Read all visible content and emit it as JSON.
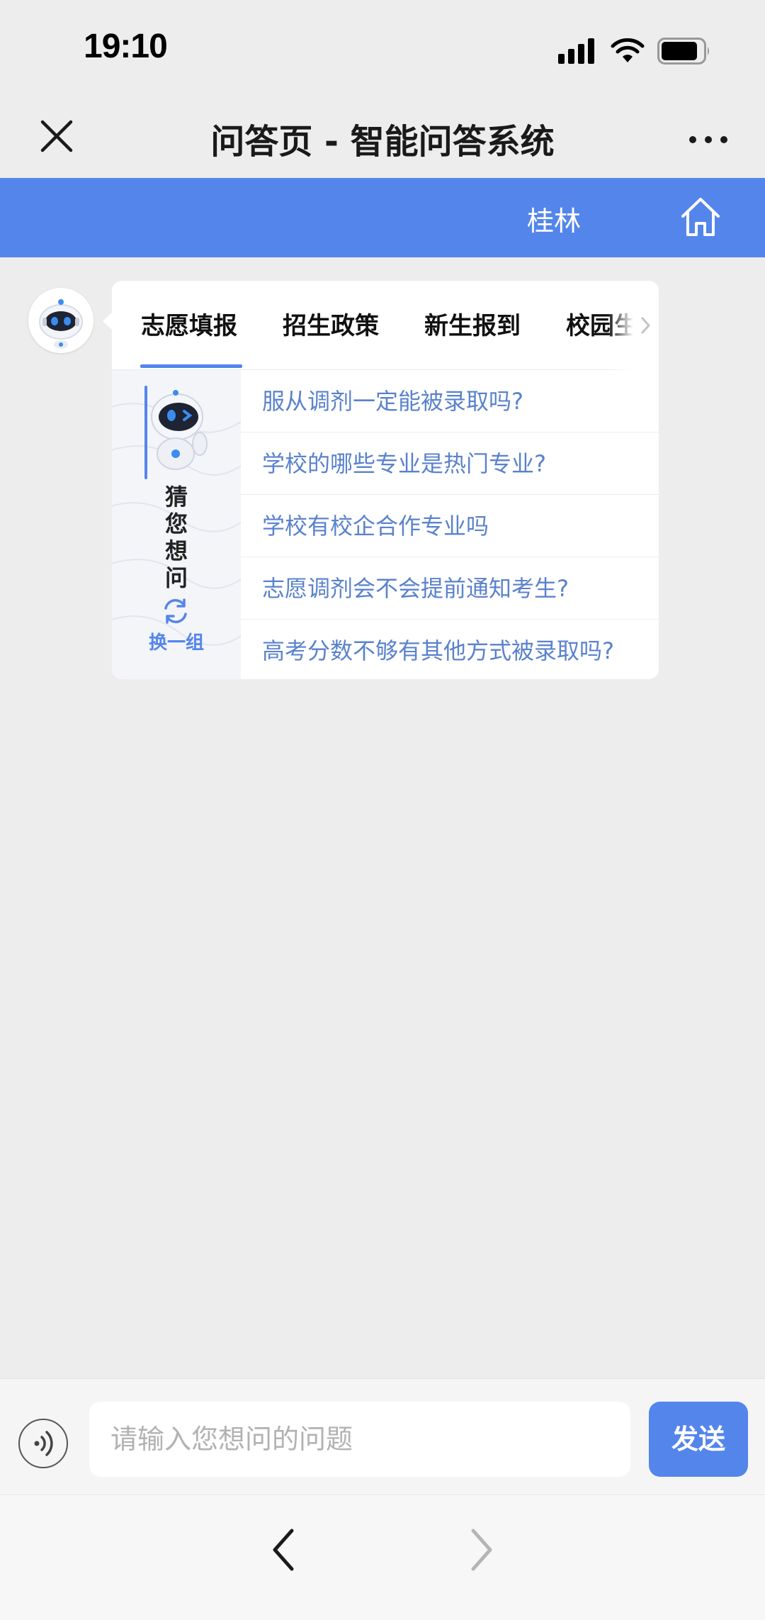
{
  "status_bar": {
    "time": "19:10",
    "icons": [
      "signal-icon",
      "wifi-icon",
      "battery-icon"
    ]
  },
  "title_bar": {
    "title": "问答页 - 智能问答系统",
    "close_icon": "close-icon",
    "more_icon": "more-icon"
  },
  "header": {
    "city": "桂林",
    "home_icon": "home-icon",
    "color": "#5485eb"
  },
  "card": {
    "tabs": [
      {
        "label": "志愿填报",
        "active": true
      },
      {
        "label": "招生政策",
        "active": false
      },
      {
        "label": "新生报到",
        "active": false
      },
      {
        "label": "校园生",
        "active": false
      }
    ],
    "guess_panel": {
      "words": [
        "猜",
        "您",
        "想",
        "问"
      ],
      "refresh_label": "换一组"
    },
    "questions": [
      "服从调剂一定能被录取吗?",
      "学校的哪些专业是热门专业?",
      "学校有校企合作专业吗",
      "志愿调剂会不会提前通知考生?",
      "高考分数不够有其他方式被录取吗?"
    ]
  },
  "input_bar": {
    "placeholder": "请输入您想问的问题",
    "value": "",
    "send_label": "发送",
    "voice_icon": "voice-icon"
  },
  "bottom_nav": {
    "back_icon": "chevron-left-icon",
    "forward_icon": "chevron-right-icon"
  },
  "colors": {
    "accent": "#5485eb",
    "question_text": "#5a82cc",
    "background": "#ededed"
  }
}
